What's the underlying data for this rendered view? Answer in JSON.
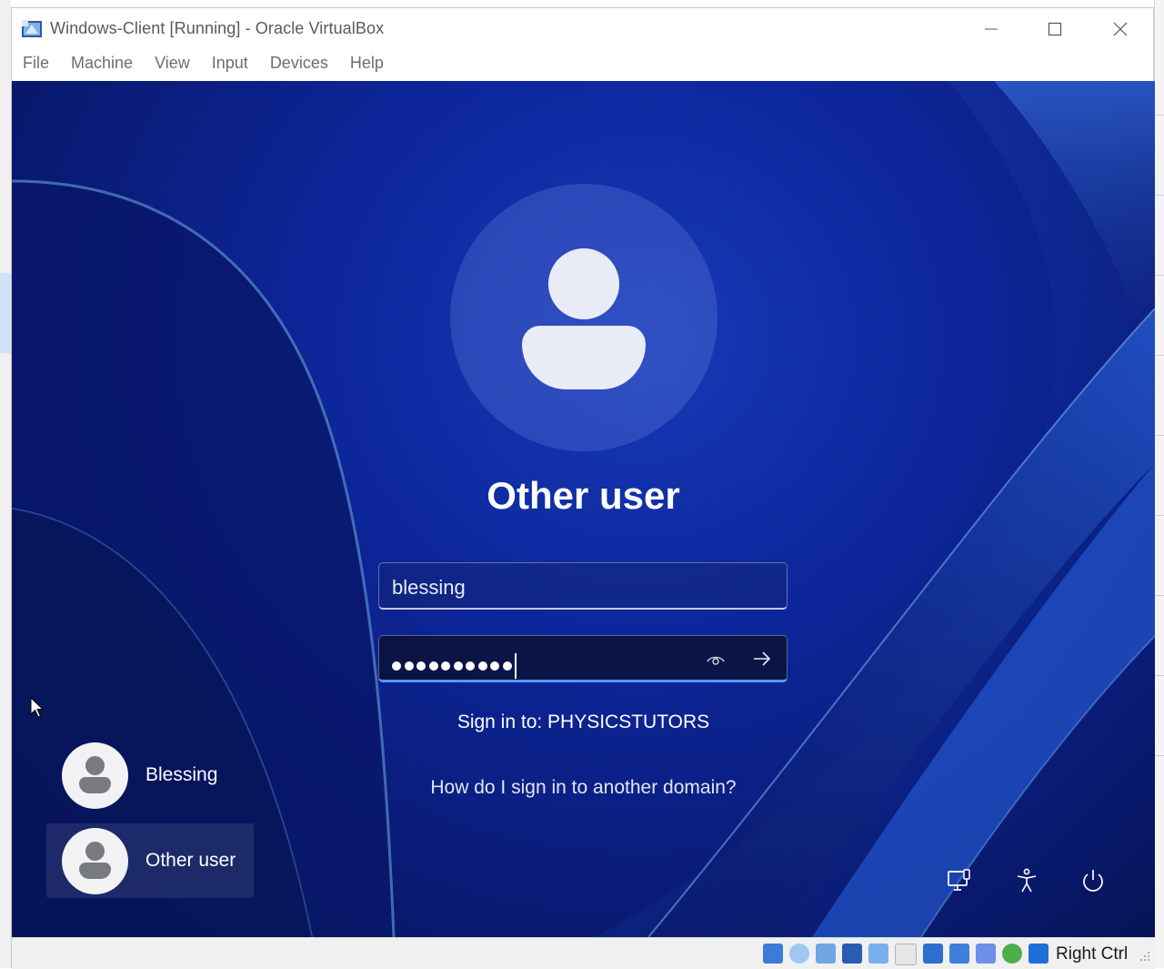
{
  "window": {
    "title": "Windows-Client [Running] - Oracle VirtualBox",
    "controls": [
      "minimize-icon",
      "maximize-icon",
      "close-icon"
    ]
  },
  "menu": {
    "items": [
      "File",
      "Machine",
      "View",
      "Input",
      "Devices",
      "Help"
    ]
  },
  "login": {
    "user_title": "Other user",
    "username_value": "blessing",
    "password_length": 10,
    "sign_in_to": "Sign in to: PHYSICSTUTORS",
    "domain_link": "How do I sign in to another domain?"
  },
  "users": [
    {
      "name": "Blessing",
      "active": false
    },
    {
      "name": "Other user",
      "active": true
    }
  ],
  "bottom_icons": [
    "network-icon",
    "accessibility-icon",
    "power-icon"
  ],
  "statusbar": {
    "host_key": "Right Ctrl",
    "icons": [
      "hard-disk-icon",
      "optical-drive-icon",
      "audio-icon",
      "network-adapter-icon",
      "usb-icon",
      "shared-folders-icon",
      "display-icon",
      "recording-icon",
      "virtualization-icon",
      "guest-additions-icon",
      "host-key-arrow-icon"
    ]
  },
  "colors": {
    "accent": "#4f9bff",
    "wallpaper": "#0f2aa6"
  }
}
